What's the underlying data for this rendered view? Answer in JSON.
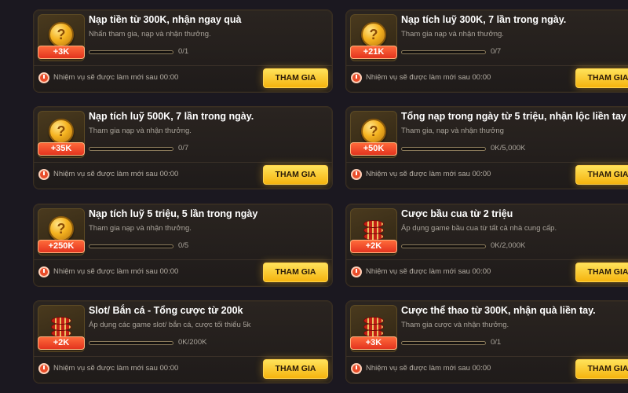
{
  "colors": {
    "accent": "#f5b40f",
    "badge": "#e3341f",
    "background": "#1b1820"
  },
  "timer_text": "Nhiệm vụ sẽ được làm mới sau 00:00",
  "join_label": "THAM GIA",
  "tasks": [
    {
      "title": "Nạp tiền từ 300K, nhận ngay quà",
      "desc": "Nhấn tham gia, nạp và nhận thưởng.",
      "reward": "+3K",
      "progress": "0/1",
      "progress_fraction": 0,
      "icon": "coin-icon"
    },
    {
      "title": "Nạp tích luỹ 300K, 7 lần trong ngày.",
      "desc": "Tham gia nạp và nhận thưởng.",
      "reward": "+21K",
      "progress": "0/7",
      "progress_fraction": 0,
      "icon": "coin-icon"
    },
    {
      "title": "Nạp tích luỹ 500K, 7 lần trong ngày.",
      "desc": "Tham gia nạp và nhận thưởng.",
      "reward": "+35K",
      "progress": "0/7",
      "progress_fraction": 0,
      "icon": "coin-icon"
    },
    {
      "title": "Tổng nạp trong ngày từ 5 triệu, nhận lộc liền tay",
      "desc": "Tham gia, nạp và nhận thưởng",
      "reward": "+50K",
      "progress": "0K/5,000K",
      "progress_fraction": 0,
      "icon": "coin-icon"
    },
    {
      "title": "Nạp tích luỹ 5 triệu, 5 lần trong ngày",
      "desc": "Tham gia nạp và nhận thưởng.",
      "reward": "+250K",
      "progress": "0/5",
      "progress_fraction": 0,
      "icon": "coin-icon"
    },
    {
      "title": "Cược bầu cua từ 2 triệu",
      "desc": "Áp dụng game bầu cua từ tất cả nhà cung cấp.",
      "reward": "+2K",
      "progress": "0K/2,000K",
      "progress_fraction": 0,
      "icon": "chips-icon"
    },
    {
      "title": "Slot/ Bắn cá - Tổng cược từ 200k",
      "desc": "Áp dụng các game slot/ bắn cá, cược tối thiểu 5k",
      "reward": "+2K",
      "progress": "0K/200K",
      "progress_fraction": 0,
      "icon": "chips-icon"
    },
    {
      "title": "Cược thể thao từ 300K, nhận quà liền tay.",
      "desc": "Tham gia cược và nhận thưởng.",
      "reward": "+3K",
      "progress": "0/1",
      "progress_fraction": 0,
      "icon": "chips-icon"
    }
  ]
}
